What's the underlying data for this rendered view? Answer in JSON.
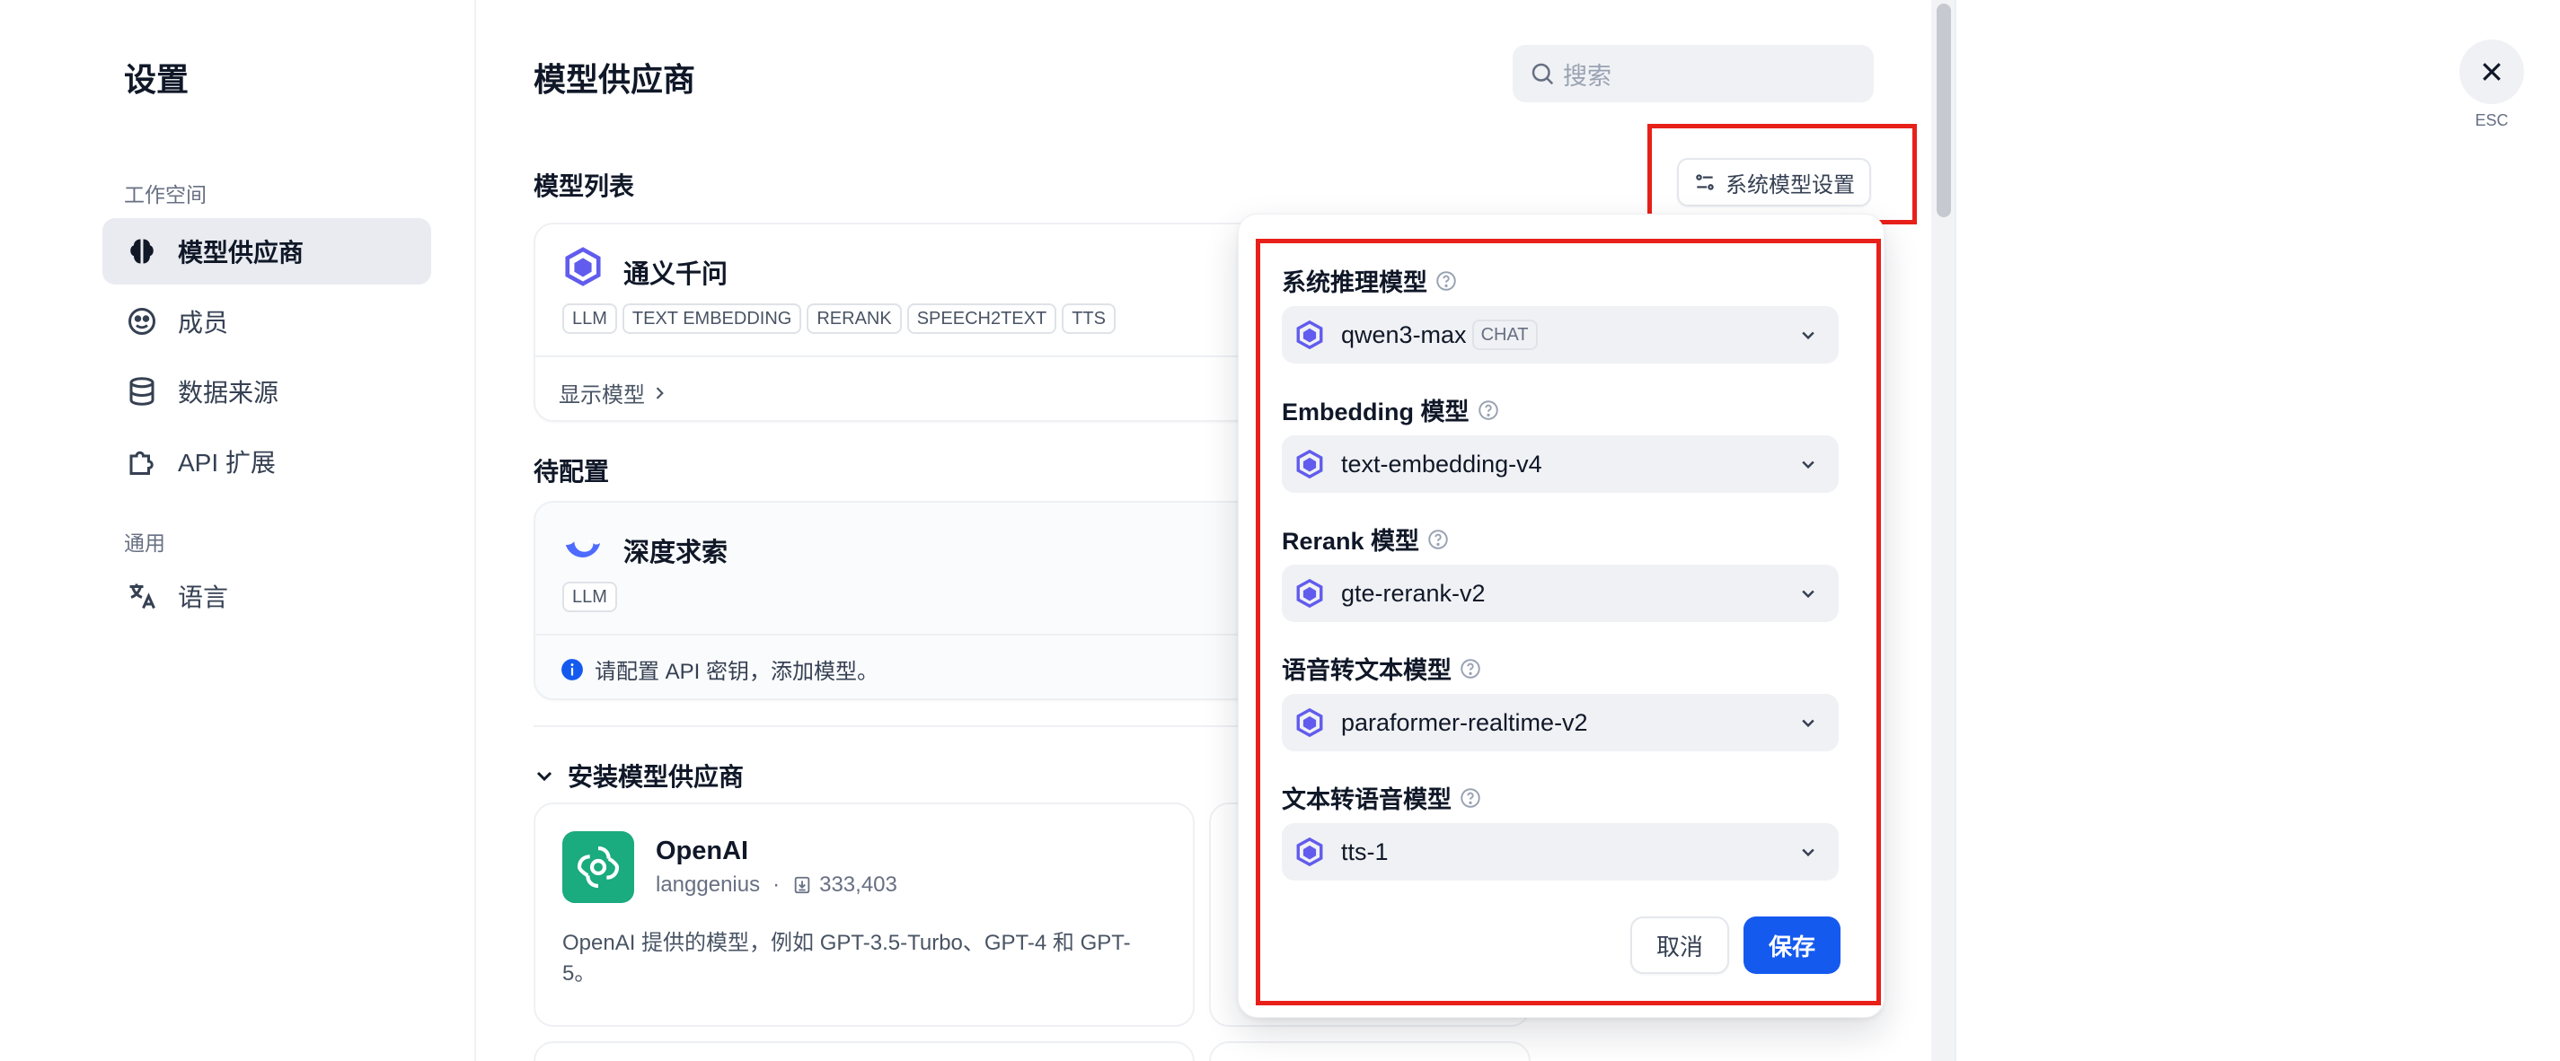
{
  "sidebar": {
    "title": "设置",
    "section_workspace": "工作空间",
    "section_general": "通用",
    "items": [
      {
        "label": "模型供应商"
      },
      {
        "label": "成员"
      },
      {
        "label": "数据来源"
      },
      {
        "label": "API 扩展"
      },
      {
        "label": "语言"
      }
    ]
  },
  "main": {
    "title": "模型供应商",
    "search_placeholder": "搜索",
    "model_list_title": "模型列表",
    "system_settings_label": "系统模型设置",
    "providers": [
      {
        "name": "通义千问",
        "tags": [
          "LLM",
          "TEXT EMBEDDING",
          "RERANK",
          "SPEECH2TEXT",
          "TTS"
        ],
        "footer": "显示模型"
      }
    ],
    "pending_title": "待配置",
    "pending": [
      {
        "name": "深度求索",
        "tags": [
          "LLM"
        ],
        "footer": "请配置 API 密钥，添加模型。"
      }
    ],
    "install_title": "安装模型供应商",
    "install_cards": [
      {
        "name": "OpenAI",
        "author": "langgenius",
        "separator": "·",
        "downloads": "333,403",
        "description_line1": "OpenAI 提供的模型，例如 GPT-3.5-Turbo、GPT-4 和 GPT-",
        "description_line2": "5。"
      }
    ]
  },
  "panel": {
    "fields": [
      {
        "label": "系统推理模型",
        "value": "qwen3-max",
        "tag": "CHAT"
      },
      {
        "label": "Embedding 模型",
        "value": "text-embedding-v4"
      },
      {
        "label": "Rerank 模型",
        "value": "gte-rerank-v2"
      },
      {
        "label": "语音转文本模型",
        "value": "paraformer-realtime-v2"
      },
      {
        "label": "文本转语音模型",
        "value": "tts-1"
      }
    ],
    "cancel_label": "取消",
    "save_label": "保存"
  },
  "close": {
    "esc_label": "ESC"
  },
  "colors": {
    "accent": "#155aef",
    "highlight": "#e8201a",
    "openai": "#1aab7f"
  }
}
